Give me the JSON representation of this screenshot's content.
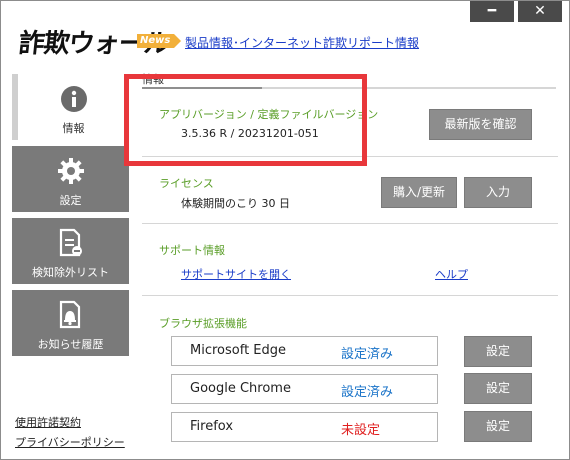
{
  "window": {
    "minimize_icon": "minimize-icon",
    "close_icon": "close-icon",
    "minimize_glyph": "━",
    "close_glyph": "✕"
  },
  "header": {
    "logo": "詐欺ウォール",
    "news_badge": "News",
    "news_link": "製品情報･インターネット詐欺リポート情報"
  },
  "sidebar": {
    "items": [
      {
        "label": "情報",
        "icon": "info-icon",
        "active": true
      },
      {
        "label": "設定",
        "icon": "gear-icon",
        "active": false
      },
      {
        "label": "検知除外リスト",
        "icon": "exclusion-list-icon",
        "active": false
      },
      {
        "label": "お知らせ履歴",
        "icon": "bell-notification-icon",
        "active": false
      }
    ],
    "links": [
      "使用許諾契約",
      "プライバシーポリシー"
    ]
  },
  "main": {
    "tab_title": "情報",
    "version": {
      "label": "アプリバージョン / 定義ファイルバージョン",
      "value": "3.5.36 R / 20231201-051",
      "button": "最新版を確認"
    },
    "license": {
      "label": "ライセンス",
      "value": "体験期間のこり 30 日",
      "buy_button": "購入/更新",
      "input_button": "入力"
    },
    "support": {
      "label": "サポート情報",
      "site_link": "サポートサイトを開く",
      "help_link": "ヘルプ"
    },
    "browser": {
      "label": "ブラウザ拡張機能",
      "rows": [
        {
          "name": "Microsoft Edge",
          "status": "設定済み",
          "status_color": "#1a73c8",
          "button": "設定"
        },
        {
          "name": "Google Chrome",
          "status": "設定済み",
          "status_color": "#1a73c8",
          "button": "設定"
        },
        {
          "name": "Firefox",
          "status": "未設定",
          "status_color": "#e02020",
          "button": "設定"
        }
      ]
    }
  },
  "colors": {
    "accent_green": "#5a9e28",
    "highlight_red": "#e8373b",
    "button_gray": "#8d8d8d",
    "sidebar_gray": "#7a7a7a"
  }
}
